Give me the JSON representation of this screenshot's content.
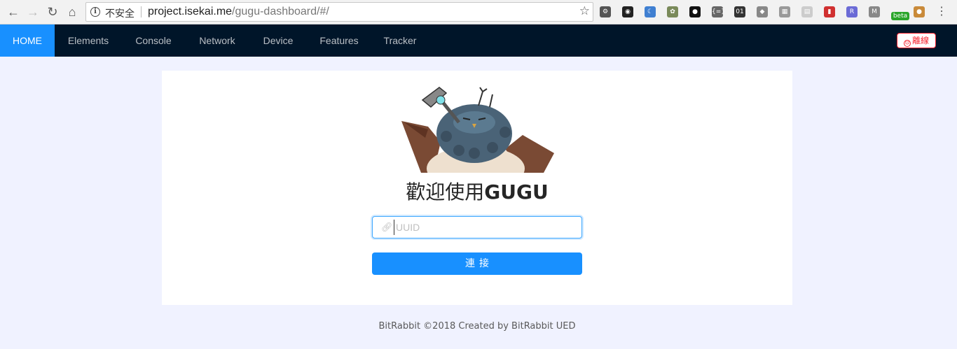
{
  "browser": {
    "security_label": "不安全",
    "url_host": "project.isekai.me",
    "url_path": "/gugu-dashboard/#/",
    "extensions": [
      {
        "name": "settings-ext",
        "glyph": "⚙",
        "color": "#555555"
      },
      {
        "name": "color-ext",
        "glyph": "◉",
        "color": "#222222"
      },
      {
        "name": "moon-ext",
        "glyph": "☾",
        "color": "#3f7fd1"
      },
      {
        "name": "bug-ext",
        "glyph": "✿",
        "color": "#7a8a5a"
      },
      {
        "name": "ghost-ext",
        "glyph": "●",
        "color": "#111111"
      },
      {
        "name": "json-ext",
        "glyph": "{=}",
        "color": "#666666"
      },
      {
        "name": "binary-ext",
        "glyph": "01",
        "color": "#333333"
      },
      {
        "name": "diamond-ext",
        "glyph": "◆",
        "color": "#888888"
      },
      {
        "name": "grid-ext",
        "glyph": "▦",
        "color": "#999999"
      },
      {
        "name": "qr-ext",
        "glyph": "▤",
        "color": "#cccccc"
      },
      {
        "name": "book-ext",
        "glyph": "▮",
        "color": "#d03030"
      },
      {
        "name": "r-ext",
        "glyph": "R",
        "color": "#6b6bd6"
      },
      {
        "name": "m-ext",
        "glyph": "M",
        "color": "#888888"
      },
      {
        "name": "beta-ext",
        "glyph": "beta",
        "color": "#2aa52a"
      },
      {
        "name": "cookie-ext",
        "glyph": "●",
        "color": "#c98a3a"
      }
    ]
  },
  "nav": {
    "items": [
      {
        "label": "HOME",
        "active": true
      },
      {
        "label": "Elements"
      },
      {
        "label": "Console"
      },
      {
        "label": "Network"
      },
      {
        "label": "Device"
      },
      {
        "label": "Features"
      },
      {
        "label": "Tracker"
      }
    ],
    "logout_label": "離線"
  },
  "main": {
    "welcome_prefix": "歡迎使用",
    "welcome_brand": "GUGU",
    "uuid_placeholder": "UUID",
    "connect_label": "連接"
  },
  "footer": {
    "text": "BitRabbit ©2018 Created by BitRabbit UED"
  },
  "colors": {
    "nav_bg": "#001529",
    "accent": "#1890ff",
    "danger": "#f5222d",
    "page_bg": "#f0f2ff"
  }
}
